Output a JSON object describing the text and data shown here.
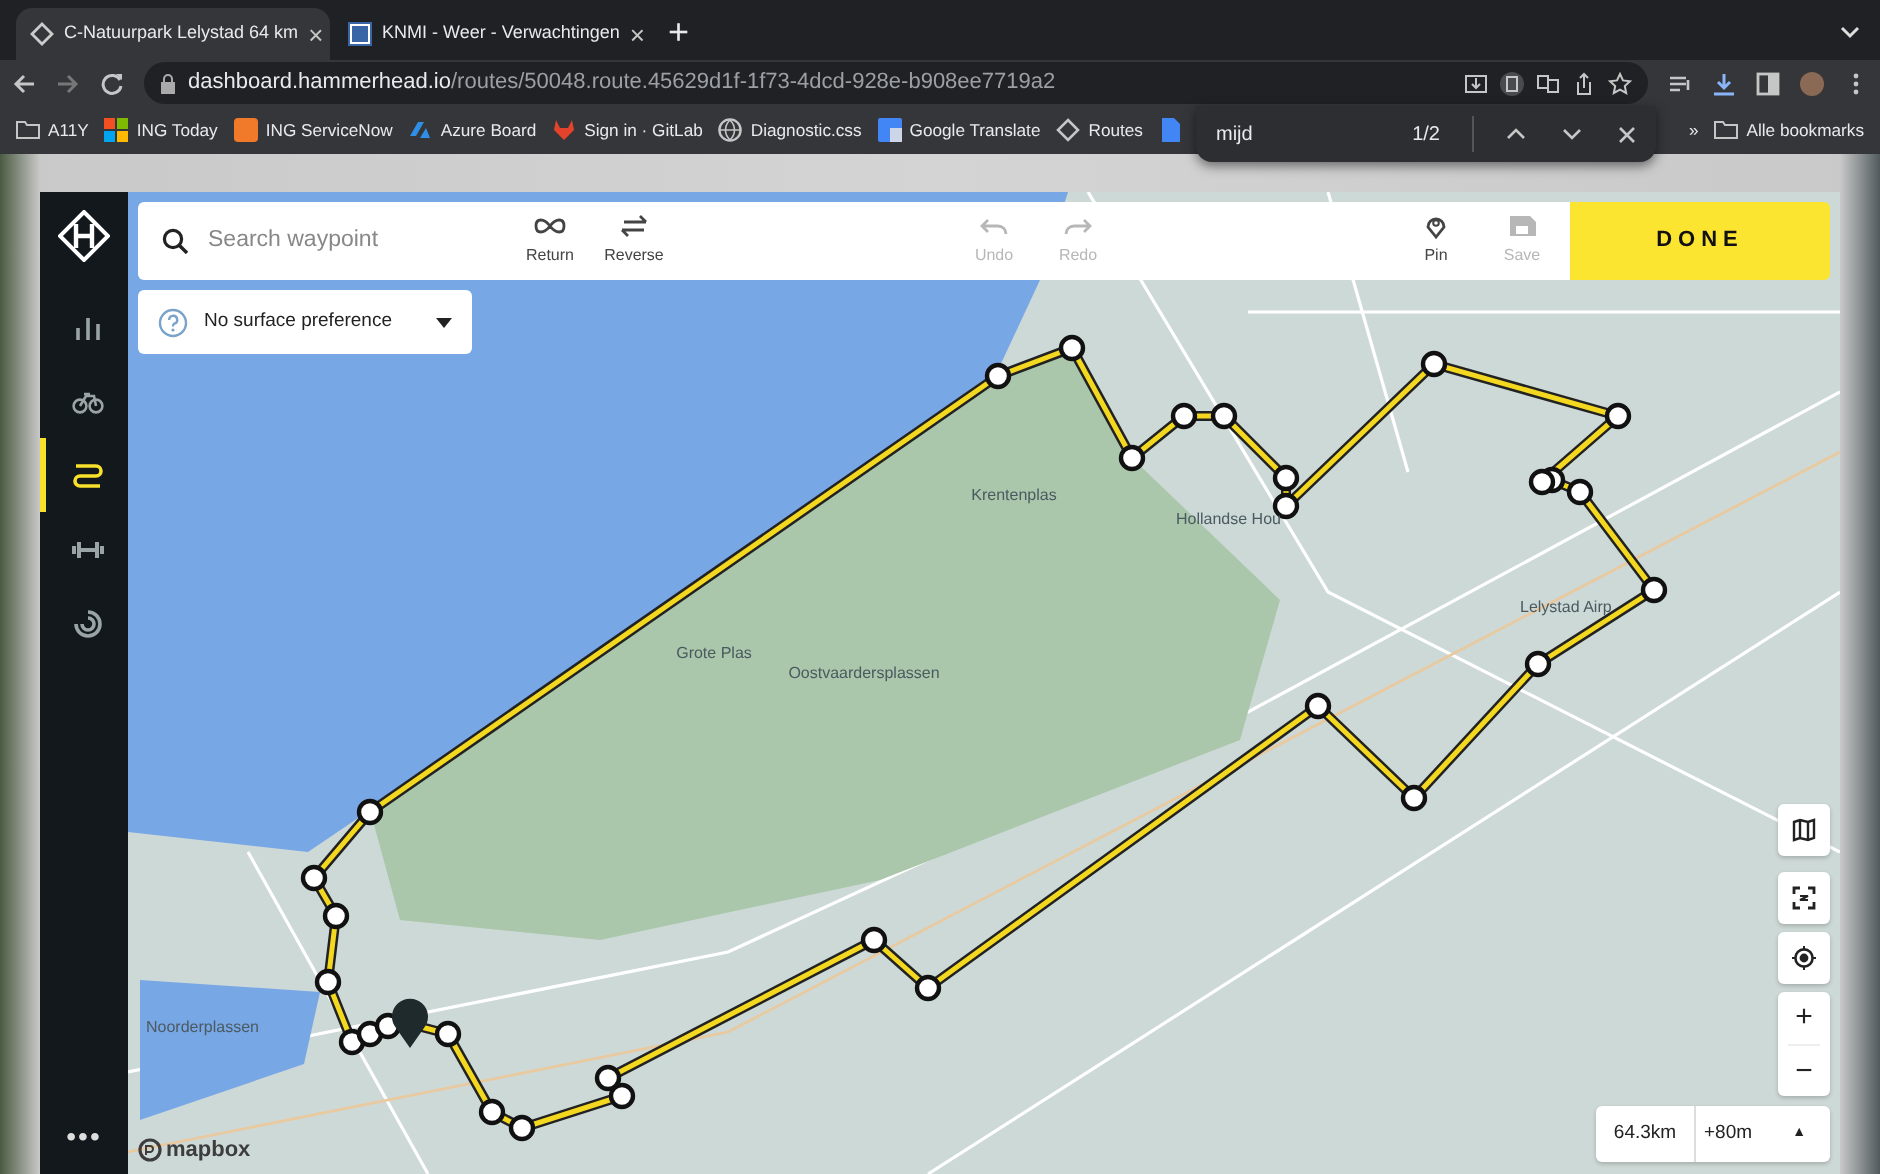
{
  "browser": {
    "tabs": [
      {
        "title": "C-Natuurpark Lelystad 64 km",
        "close": "×",
        "selected": true
      },
      {
        "title": "KNMI - Weer - Verwachtingen",
        "close": "×",
        "selected": false
      }
    ],
    "new_tab": "+",
    "address": {
      "host": "dashboard.hammerhead.io",
      "path": "/routes/50048.route.45629d1f-1f73-4dcd-928e-b908ee7719a2"
    },
    "bookmarks": [
      {
        "kind": "folder",
        "label": "A11Y"
      },
      {
        "kind": "grid",
        "label": "ING Today"
      },
      {
        "kind": "orange",
        "label": "ING ServiceNow"
      },
      {
        "kind": "azure",
        "label": "Azure Board"
      },
      {
        "kind": "fox",
        "label": "Sign in · GitLab"
      },
      {
        "kind": "globe",
        "label": "Diagnostic.css"
      },
      {
        "kind": "translate",
        "label": "Google Translate"
      },
      {
        "kind": "logo",
        "label": "Routes"
      },
      {
        "kind": "doc"
      }
    ],
    "overflow": "»",
    "all_bookmarks": "Alle bookmarks"
  },
  "find_bar": {
    "query": "mijd",
    "count": "1/2"
  },
  "app": {
    "sidebar": {
      "items": [
        {
          "kind": "stats",
          "selected": false
        },
        {
          "kind": "bike",
          "selected": false
        },
        {
          "kind": "route",
          "selected": true
        },
        {
          "kind": "workout",
          "selected": false
        },
        {
          "kind": "spiral",
          "selected": false
        }
      ],
      "more": "•••"
    },
    "search": {
      "placeholder": "Search waypoint"
    },
    "tools": [
      {
        "kind": "return",
        "label": "Return",
        "disabled": false
      },
      {
        "kind": "reverse",
        "label": "Reverse",
        "disabled": false
      },
      {
        "kind": "undo",
        "label": "Undo",
        "disabled": true
      },
      {
        "kind": "redo",
        "label": "Redo",
        "disabled": true
      },
      {
        "kind": "pin",
        "label": "Pin",
        "disabled": false
      },
      {
        "kind": "save",
        "label": "Save",
        "disabled": true
      }
    ],
    "done": "DONE",
    "surface": {
      "value": "No surface preference"
    },
    "map": {
      "labels": [
        "Krentenplas",
        "Grote Plas",
        "Oostvaardersplassen",
        "Hollandse Hou",
        "Lelystad Airp",
        "Noorderplassen"
      ],
      "attribution": "mapbox"
    },
    "zoom": {
      "in": "+",
      "out": "−"
    },
    "stats": {
      "distance": "64.3km",
      "elevation": "+80m",
      "toggle": "▲"
    }
  }
}
